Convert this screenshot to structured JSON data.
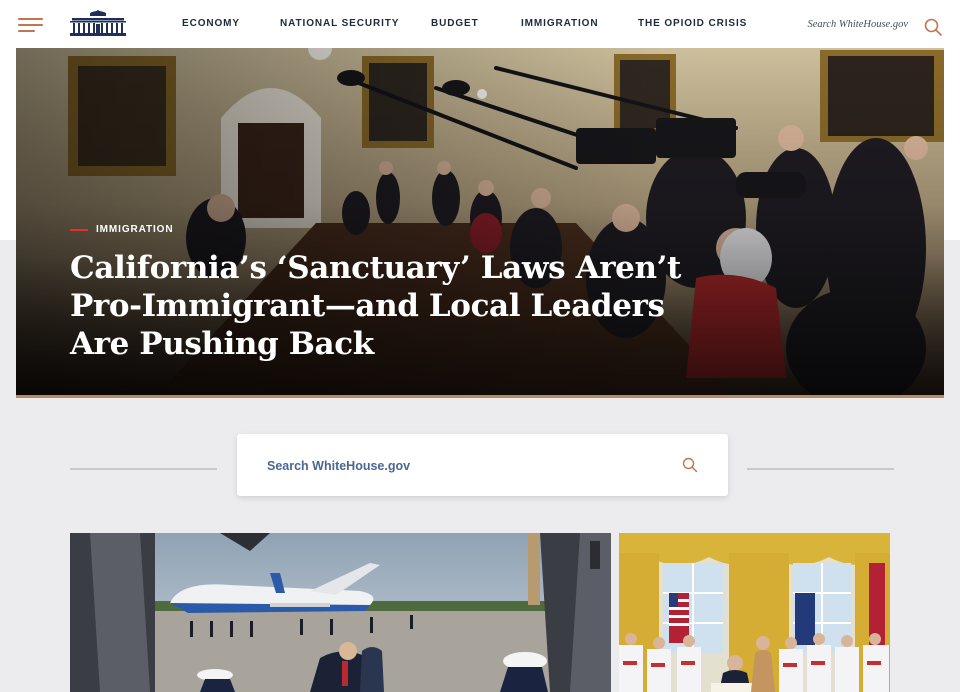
{
  "header": {
    "nav": [
      {
        "label": "ECONOMY"
      },
      {
        "label": "NATIONAL SECURITY"
      },
      {
        "label": "BUDGET"
      },
      {
        "label": "IMMIGRATION"
      },
      {
        "label": "THE OPIOID CRISIS"
      }
    ],
    "search_placeholder": "Search WhiteHouse.gov"
  },
  "hero": {
    "category": "IMMIGRATION",
    "title": "California’s ‘Sanctuary’ Laws Aren’t Pro-Immigrant—and Local Leaders Are Pushing Back"
  },
  "search": {
    "placeholder": "Search WhiteHouse.gov"
  },
  "colors": {
    "accent_orange": "#c2754e",
    "category_red": "#e0322a",
    "nav_text": "#1f2a3c",
    "hero_underline": "#b68c5c",
    "search_text": "#4b6690",
    "page_bg": "#ececee"
  },
  "icons": {
    "menu": "hamburger-menu-icon",
    "logo": "white-house-logo",
    "search": "search-icon"
  }
}
